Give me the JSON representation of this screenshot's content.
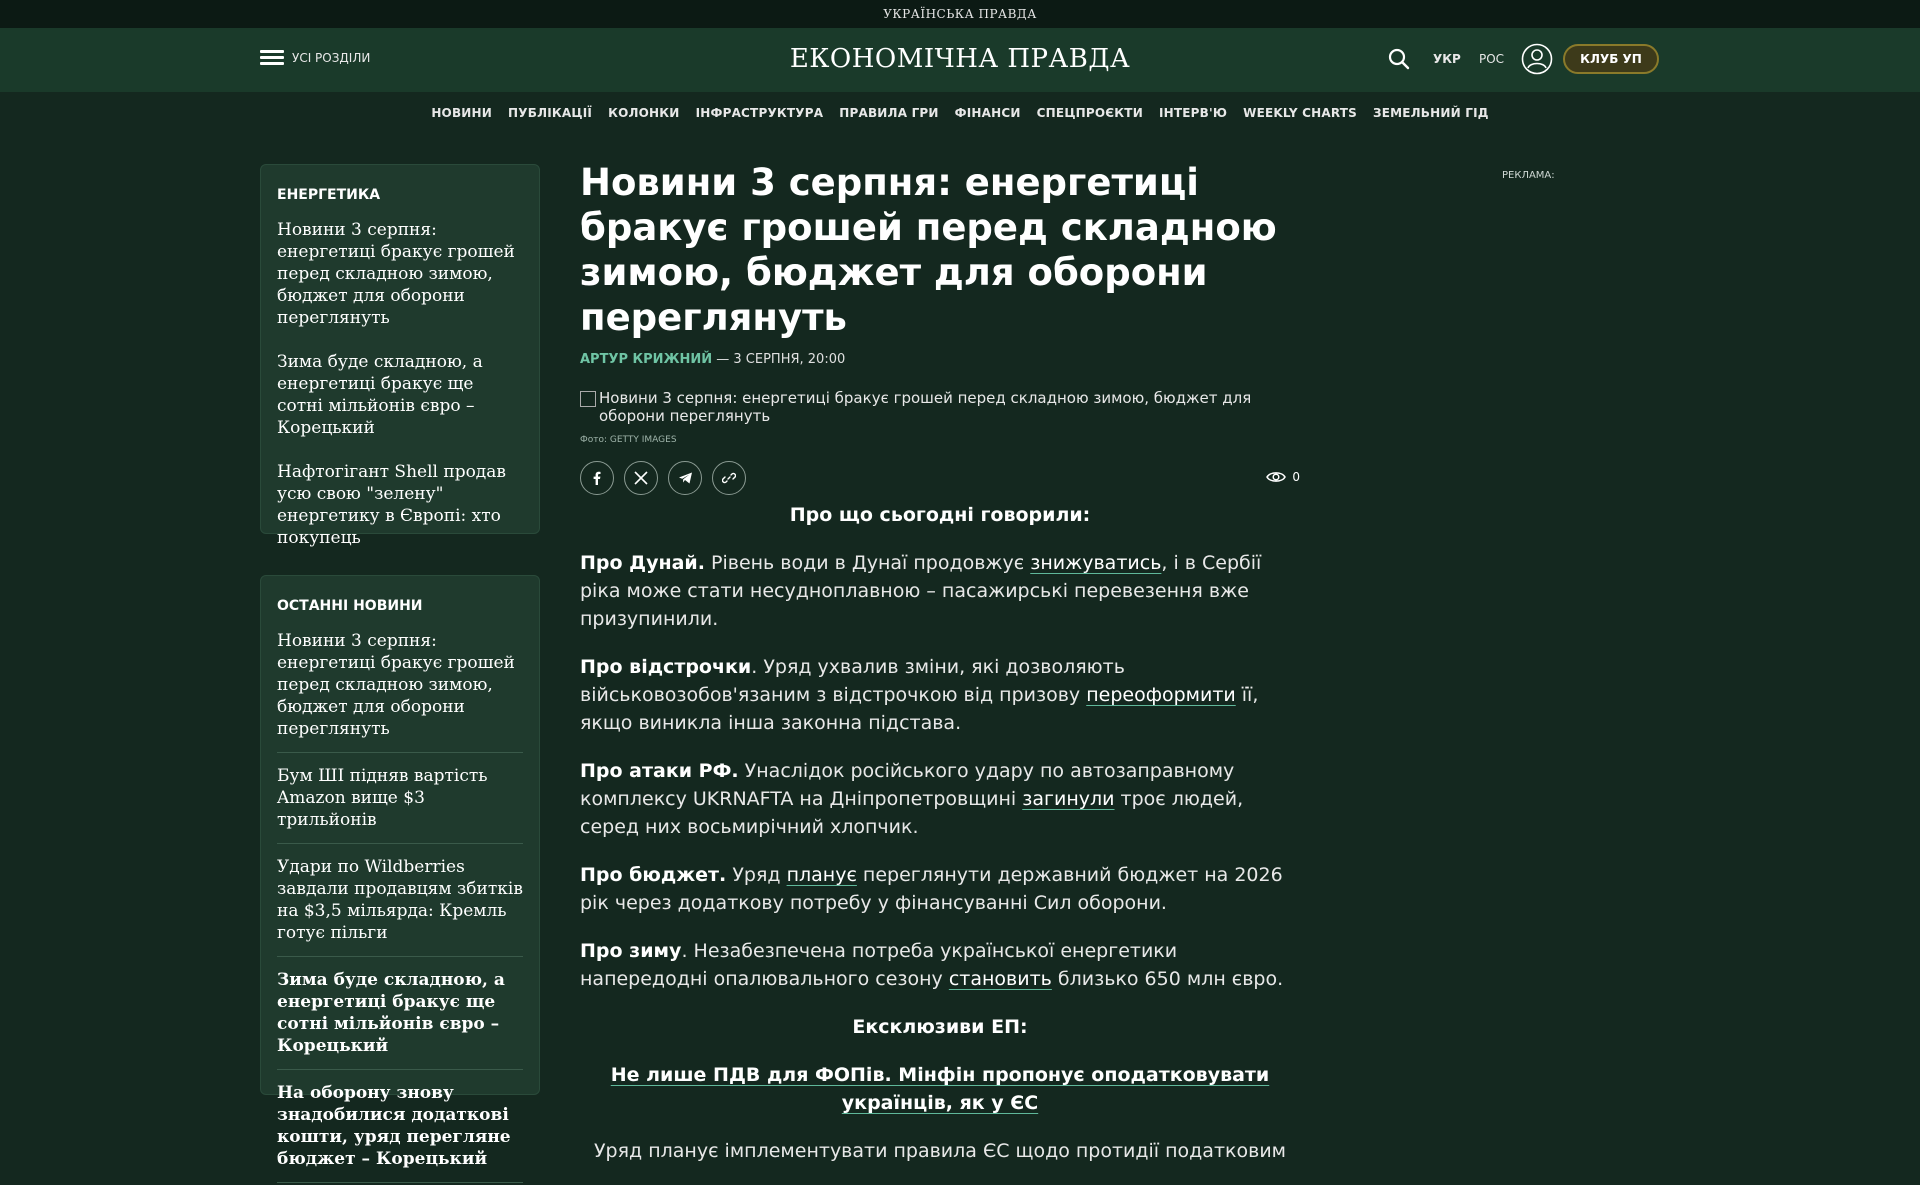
{
  "top_strip": {
    "label": "УКРАЇНСЬКА ПРАВДА"
  },
  "header": {
    "menu_label": "УСІ РОЗДІЛИ",
    "logo": "ЕКОНОМІЧНА ПРАВДА",
    "lang_ukr": "УКР",
    "lang_ros": "РОС",
    "club_button": "КЛУБ УП"
  },
  "nav": [
    "НОВИНИ",
    "ПУБЛІКАЦІЇ",
    "КОЛОНКИ",
    "ІНФРАСТРУКТУРА",
    "ПРАВИЛА ГРИ",
    "ФІНАНСИ",
    "СПЕЦПРОЄКТИ",
    "ІНТЕРВ'Ю",
    "WEEKLY CHARTS",
    "ЗЕМЕЛЬНИЙ ГІД"
  ],
  "sidebar_energy": {
    "title": "ЕНЕРГЕТИКА",
    "items": [
      "Новини 3 серпня: енергетиці бракує грошей перед складною зимою, бюджет для оборони переглянуть",
      "Зима буде складною, а енергетиці бракує ще сотні мільйонів євро – Корецький",
      "Нафтогігант Shell продав усю свою \"зелену\" енергетику в Європі: хто покупець"
    ]
  },
  "sidebar_latest": {
    "title": "ОСТАННІ НОВИНИ",
    "items": [
      "Новини 3 серпня: енергетиці бракує грошей перед складною зимою, бюджет для оборони переглянуть",
      "Бум ШІ підняв вартість Amazon вище $3 трильйонів",
      "Удари по Wildberries завдали продавцям збитків на $3,5 мільярда: Кремль готує пільги",
      "Зима буде складною, а енергетиці бракує ще сотні мільйонів євро – Корецький",
      "На оборону знову знадобилися додаткові кошти, уряд перегляне бюджет – Корецький"
    ]
  },
  "article": {
    "title": "Новини 3 серпня: енергетиці бракує грошей перед складною зимою, бюджет для оборони переглянуть",
    "author": "АРТУР КРИЖНИЙ",
    "date": "— 3 СЕРПНЯ, 20:00",
    "image_alt": "Новини 3 серпня: енергетиці бракує грошей перед складною зимою, бюджет для оборони переглянуть",
    "photo_credit": "Фото: GETTY IMAGES",
    "views": "0",
    "heading_today": "Про що сьогодні говорили:",
    "p1_lead": "Про Дунай.",
    "p1_a": " Рівень води в Дунаї продовжує ",
    "p1_link": "знижуватись",
    "p1_b": ", і в Сербії ріка може стати несудноплавною – пасажирські перевезення вже призупинили.",
    "p2_lead": "Про відстрочки",
    "p2_a": ". Уряд ухвалив зміни, які дозволяють військовозобов'язаним з відстрочкою від призову ",
    "p2_link": "переоформити",
    "p2_b": " її, якщо виникла інша законна підстава.",
    "p3_lead": "Про атаки РФ.",
    "p3_a": " Унаслідок російського удару по автозаправному комплексу UKRNAFTA на Дніпропетровщині ",
    "p3_link": "загинули",
    "p3_b": " троє людей, серед них восьмирічний хлопчик.",
    "p4_lead": "Про бюджет.",
    "p4_a": " Уряд ",
    "p4_link": "планує",
    "p4_b": " переглянути державний бюджет на 2026 рік через додаткову потребу у фінансуванні Сил оборони.",
    "p5_lead": "Про зиму",
    "p5_a": ". Незабезпечена потреба української енергетики напередодні опалювального сезону ",
    "p5_link": "становить",
    "p5_b": " близько 650 млн євро.",
    "heading_exclusive": "Ексклюзиви ЕП:",
    "exclusive_link": "Не лише ПДВ для ФОПів. Мінфін пропонує оподатковувати українців, як у ЄС",
    "last_para": "Уряд планує імплементувати правила ЄС щодо протидії податковим"
  },
  "ad_label": "РЕКЛАМА:"
}
